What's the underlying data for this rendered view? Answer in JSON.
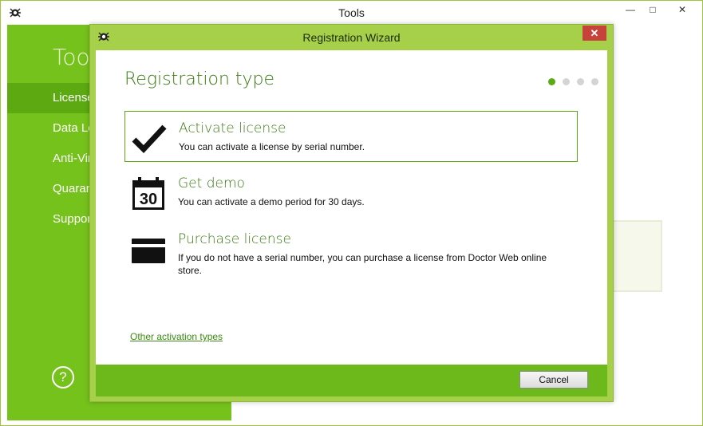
{
  "tools_window": {
    "title": "Tools",
    "minimize_glyph": "—",
    "maximize_glyph": "□",
    "close_glyph": "✕",
    "heading": "Tools",
    "sidebar_items": [
      {
        "label": "License",
        "active": true
      },
      {
        "label": "Data Loss Prevention",
        "active": false
      },
      {
        "label": "Anti-Virus Network",
        "active": false
      },
      {
        "label": "Quarantine",
        "active": false
      },
      {
        "label": "Support",
        "active": false
      }
    ],
    "help_glyph": "?"
  },
  "wizard": {
    "title": "Registration Wizard",
    "close_glyph": "✕",
    "heading": "Registration type",
    "progress": {
      "current_step": 1,
      "total_steps": 4
    },
    "options": [
      {
        "title": "Activate license",
        "description": "You can activate a license by serial number.",
        "icon": "checkmark-icon",
        "selected": true
      },
      {
        "title": "Get demo",
        "description": "You can activate a demo period for 30 days.",
        "icon": "calendar-icon",
        "icon_text": "30",
        "selected": false
      },
      {
        "title": "Purchase license",
        "description": "If you do not have a serial number, you can purchase a license from Doctor Web online store.",
        "icon": "credit-card-icon",
        "selected": false
      }
    ],
    "other_link": "Other activation types",
    "cancel_label": "Cancel"
  },
  "colors": {
    "accent_green": "#76c21c",
    "dark_green_text": "#3b7a12",
    "wizard_frame": "#a6cf4a",
    "close_red": "#c7423a"
  }
}
